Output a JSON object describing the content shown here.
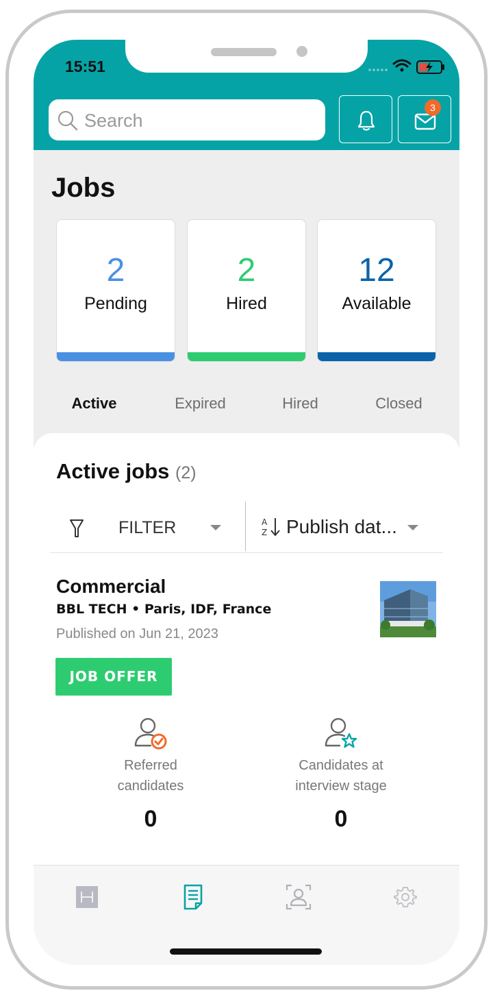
{
  "status_bar": {
    "time": "15:51"
  },
  "header": {
    "search_placeholder": "Search",
    "icons": [
      "search-icon",
      "bell-icon",
      "mail-icon"
    ],
    "messages_badge": "3",
    "accent_color": "#05a3a6"
  },
  "page": {
    "title": "Jobs"
  },
  "stats": [
    {
      "value": "2",
      "label": "Pending",
      "color": "#4a90e2"
    },
    {
      "value": "2",
      "label": "Hired",
      "color": "#2ecc71"
    },
    {
      "value": "12",
      "label": "Available",
      "color": "#0a63ab"
    }
  ],
  "tabs": [
    {
      "label": "Active",
      "active": true
    },
    {
      "label": "Expired",
      "active": false
    },
    {
      "label": "Hired",
      "active": false
    },
    {
      "label": "Closed",
      "active": false
    }
  ],
  "list": {
    "title": "Active jobs",
    "count": "(2)",
    "filter_label": "FILTER",
    "sort_label": "Publish dat..."
  },
  "job": {
    "title": "Commercial",
    "company": "BBL TECH • Paris, IDF, France",
    "published": "Published on Jun 21, 2023",
    "tag": "JOB OFFER",
    "tag_color": "#2ecc71",
    "metrics": [
      {
        "label": "Referred\ncandidates",
        "value": "0",
        "icon": "user-check-icon"
      },
      {
        "label": "Candidates at\ninterview stage",
        "value": "0",
        "icon": "user-star-icon"
      }
    ]
  },
  "tabbar": {
    "items": [
      "dashboard-icon",
      "jobs-icon",
      "candidates-icon",
      "settings-icon"
    ],
    "active": "jobs-icon"
  }
}
